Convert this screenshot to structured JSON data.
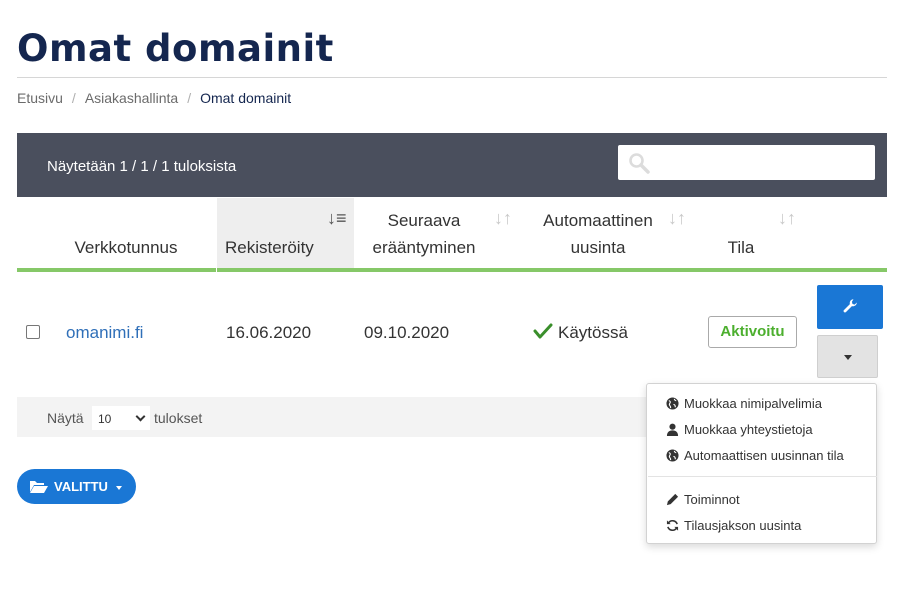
{
  "page": {
    "title": "Omat domainit"
  },
  "breadcrumb": [
    "Etusivu",
    "Asiakashallinta",
    "Omat domainit"
  ],
  "table_bar": {
    "result_info": "Näytetään 1 / 1 / 1 tuloksista",
    "search_placeholder": ""
  },
  "columns": [
    {
      "label": "Verkkotunnus"
    },
    {
      "label": "Rekisteröity"
    },
    {
      "label_line1": "Seuraava",
      "label_line2": "erääntyminen"
    },
    {
      "label_line1": "Automaattinen",
      "label_line2": "uusinta"
    },
    {
      "label": "Tila"
    }
  ],
  "rows": [
    {
      "domain": "omanimi.fi",
      "registered": "16.06.2020",
      "next_due": "09.10.2020",
      "auto_renewal": "Käytössä",
      "status": "Aktivoitu"
    }
  ],
  "footer": {
    "show_label": "Näytä",
    "page_size": "10",
    "results_label": "tulokset"
  },
  "bulk_button": {
    "label": "VALITTU"
  },
  "action_menu": {
    "items": [
      {
        "label": "Muokkaa nimipalvelimia",
        "icon": "globe-icon"
      },
      {
        "label": "Muokkaa yhteystietoja",
        "icon": "user-icon"
      },
      {
        "label": "Automaattisen uusinnan tila",
        "icon": "globe-icon"
      },
      {
        "label": "Toiminnot",
        "icon": "pencil-icon"
      },
      {
        "label": "Tilausjakson uusinta",
        "icon": "refresh-icon"
      }
    ]
  },
  "colors": {
    "primary": "#1a77d5",
    "header_bar": "#4a4f5d",
    "accent_green": "#86c868",
    "status_green": "#4caf2e",
    "title": "#14264f"
  }
}
